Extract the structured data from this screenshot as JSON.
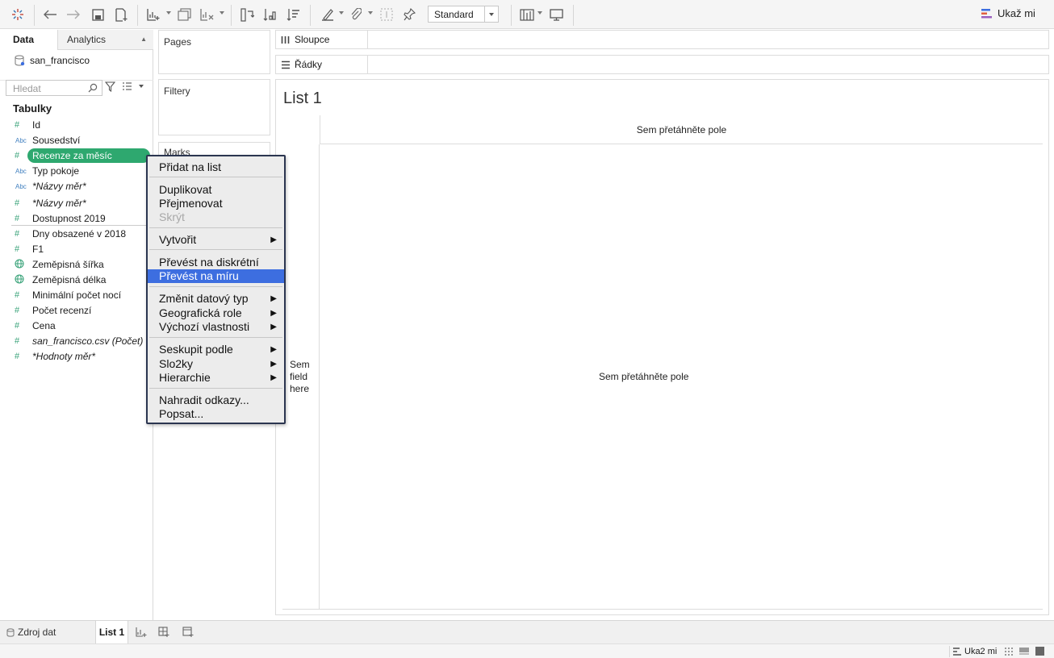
{
  "toolbar": {
    "view_select": "Standard",
    "show_me": "Ukaž mi"
  },
  "data_pane": {
    "tab_data": "Data",
    "tab_analytics": "Analytics",
    "datasource_name": "san_francisco",
    "search_placeholder": "Hledat",
    "tables_heading": "Tabulky",
    "fields": [
      {
        "icon": "#",
        "name": "Id"
      },
      {
        "icon": "Abc",
        "name": "Sousedství"
      },
      {
        "icon": "#",
        "name": "Recenze za měsíc"
      },
      {
        "icon": "Abc",
        "name": "Typ pokoje"
      },
      {
        "icon": "Abc",
        "name": "*Názvy měr*"
      },
      {
        "icon": "#",
        "name": "*Názvy měr*"
      },
      {
        "icon": "#",
        "name": "Dostupnost 2019"
      },
      {
        "icon": "#",
        "name": "Dny obsazené v 2018"
      },
      {
        "icon": "#",
        "name": "F1"
      },
      {
        "icon": "globe",
        "name": "Zeměpisná šířka"
      },
      {
        "icon": "globe",
        "name": "Zeměpisná délka"
      },
      {
        "icon": "#",
        "name": "Minimální počet nocí"
      },
      {
        "icon": "#",
        "name": "Počet recenzí"
      },
      {
        "icon": "#",
        "name": "Cena"
      },
      {
        "icon": "#",
        "name": "san_francisco.csv (Počet)"
      },
      {
        "icon": "#",
        "name": "*Hodnoty měr*"
      }
    ]
  },
  "cards": {
    "pages": "Pages",
    "filters": "Filtery",
    "marks": "Marks"
  },
  "shelves": {
    "columns": "Sloupce",
    "rows": "Řádky"
  },
  "canvas": {
    "title": "List 1",
    "column_drop": "Sem přetáhněte pole",
    "row_drop_line1": "Sem",
    "row_drop_line2": "field",
    "row_drop_line3": "here",
    "body_drop": "Sem přetáhněte pole"
  },
  "context_menu": {
    "add_to_sheet": "Přidat na list",
    "duplicate": "Duplikovat",
    "rename": "Přejmenovat",
    "hide": "Skrýt",
    "create": "Vytvořit",
    "convert_discrete": "Převést na diskrétní",
    "convert_measure": "Převést na míru",
    "change_type": "Změnit datový typ",
    "geo_role": "Geografická role",
    "default_props": "Výchozí vlastnosti",
    "group_by": "Seskupit podle",
    "folders": "Slo2ky",
    "hierarchy": "Hierarchie",
    "replace_refs": "Nahradit odkazy...",
    "describe": "Popsat..."
  },
  "bottom": {
    "datasource_tab": "Zdroj dat",
    "sheet_tab": "List 1",
    "status_show_me": "Uka2 mi"
  },
  "colors": {
    "selected_field": "#2ea86f",
    "menu_highlight": "#3d6ee0",
    "dimension_icon": "#3f7fbf",
    "measure_icon": "#3aa37a"
  }
}
